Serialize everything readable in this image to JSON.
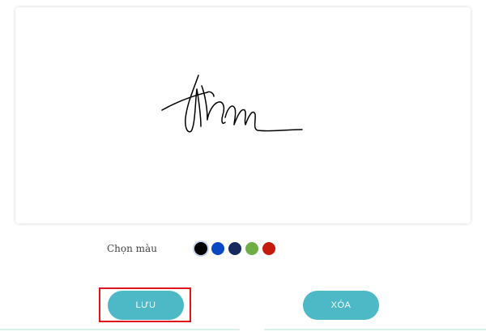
{
  "color_picker": {
    "label": "Chọn màu",
    "selected": "black",
    "swatches": [
      {
        "name": "black",
        "hex": "#000000"
      },
      {
        "name": "blue",
        "hex": "#0b47c4"
      },
      {
        "name": "navy",
        "hex": "#13295f"
      },
      {
        "name": "green",
        "hex": "#6fae45"
      },
      {
        "name": "red",
        "hex": "#c51a0e"
      }
    ]
  },
  "buttons": {
    "save_label": "LƯU",
    "clear_label": "XÓA",
    "color": "#4db8c6"
  },
  "annotation": {
    "highlight_color": "#e0141b"
  },
  "signature": {
    "stroke_color": "#000000"
  }
}
